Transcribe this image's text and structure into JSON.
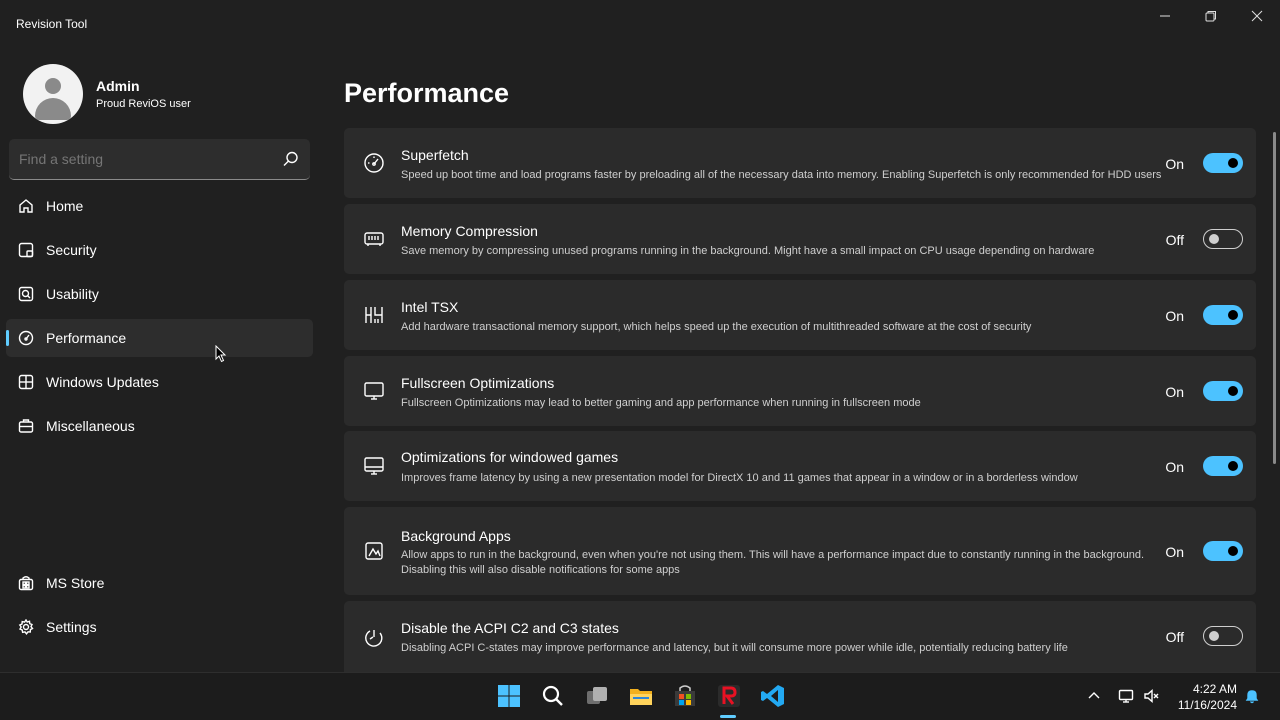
{
  "app": {
    "title": "Revision Tool"
  },
  "profile": {
    "name": "Admin",
    "subtitle": "Proud ReviOS user"
  },
  "search": {
    "placeholder": "Find a setting"
  },
  "sidebar": {
    "items": [
      {
        "label": "Home",
        "icon": "home-icon"
      },
      {
        "label": "Security",
        "icon": "shield-icon"
      },
      {
        "label": "Usability",
        "icon": "usability-icon"
      },
      {
        "label": "Performance",
        "icon": "gauge-icon",
        "active": true
      },
      {
        "label": "Windows Updates",
        "icon": "update-icon"
      },
      {
        "label": "Miscellaneous",
        "icon": "toolbox-icon"
      }
    ],
    "bottom_items": [
      {
        "label": "MS Store",
        "icon": "store-icon"
      },
      {
        "label": "Settings",
        "icon": "gear-icon"
      }
    ]
  },
  "main": {
    "title": "Performance",
    "settings": [
      {
        "title": "Superfetch",
        "description": "Speed up boot time and load programs faster by preloading all of the necessary data into memory. Enabling Superfetch is only recommended for HDD users",
        "state": "On",
        "icon": "gauge-icon"
      },
      {
        "title": "Memory Compression",
        "description": "Save memory by compressing unused programs running in the background. Might have a small impact on CPU usage depending on hardware",
        "state": "Off",
        "icon": "memory-icon"
      },
      {
        "title": "Intel TSX",
        "description": "Add hardware transactional memory support, which helps speed up the execution of multithreaded software at the cost of security",
        "state": "On",
        "icon": "chip-icon"
      },
      {
        "title": "Fullscreen Optimizations",
        "description": "Fullscreen Optimizations may lead to better gaming and app performance when running in fullscreen mode",
        "state": "On",
        "icon": "monitor-icon"
      },
      {
        "title": "Optimizations for windowed games",
        "description": "Improves frame latency by using a new presentation model for DirectX 10 and 11 games that appear in a window or in a borderless window",
        "state": "On",
        "icon": "monitor-window-icon"
      },
      {
        "title": "Background Apps",
        "description": "Allow apps to run in the background, even when you're not using them. This will have a performance impact due to constantly running in the background. Disabling this will also disable notifications for some apps",
        "state": "On",
        "icon": "background-apps-icon"
      },
      {
        "title": "Disable the ACPI C2 and C3 states",
        "description": "Disabling ACPI C-states may improve performance and latency, but it will consume more power while idle, potentially reducing battery life",
        "state": "Off",
        "icon": "power-state-icon"
      }
    ]
  },
  "taskbar": {
    "apps": [
      "windows-start-icon",
      "search-icon",
      "task-view-icon",
      "file-explorer-icon",
      "ms-store-icon",
      "revision-tool-icon",
      "vscode-icon"
    ],
    "time": "4:22 AM",
    "date": "11/16/2024"
  },
  "colors": {
    "accent": "#4cc2ff",
    "background": "#202020",
    "card": "#2b2b2b"
  }
}
